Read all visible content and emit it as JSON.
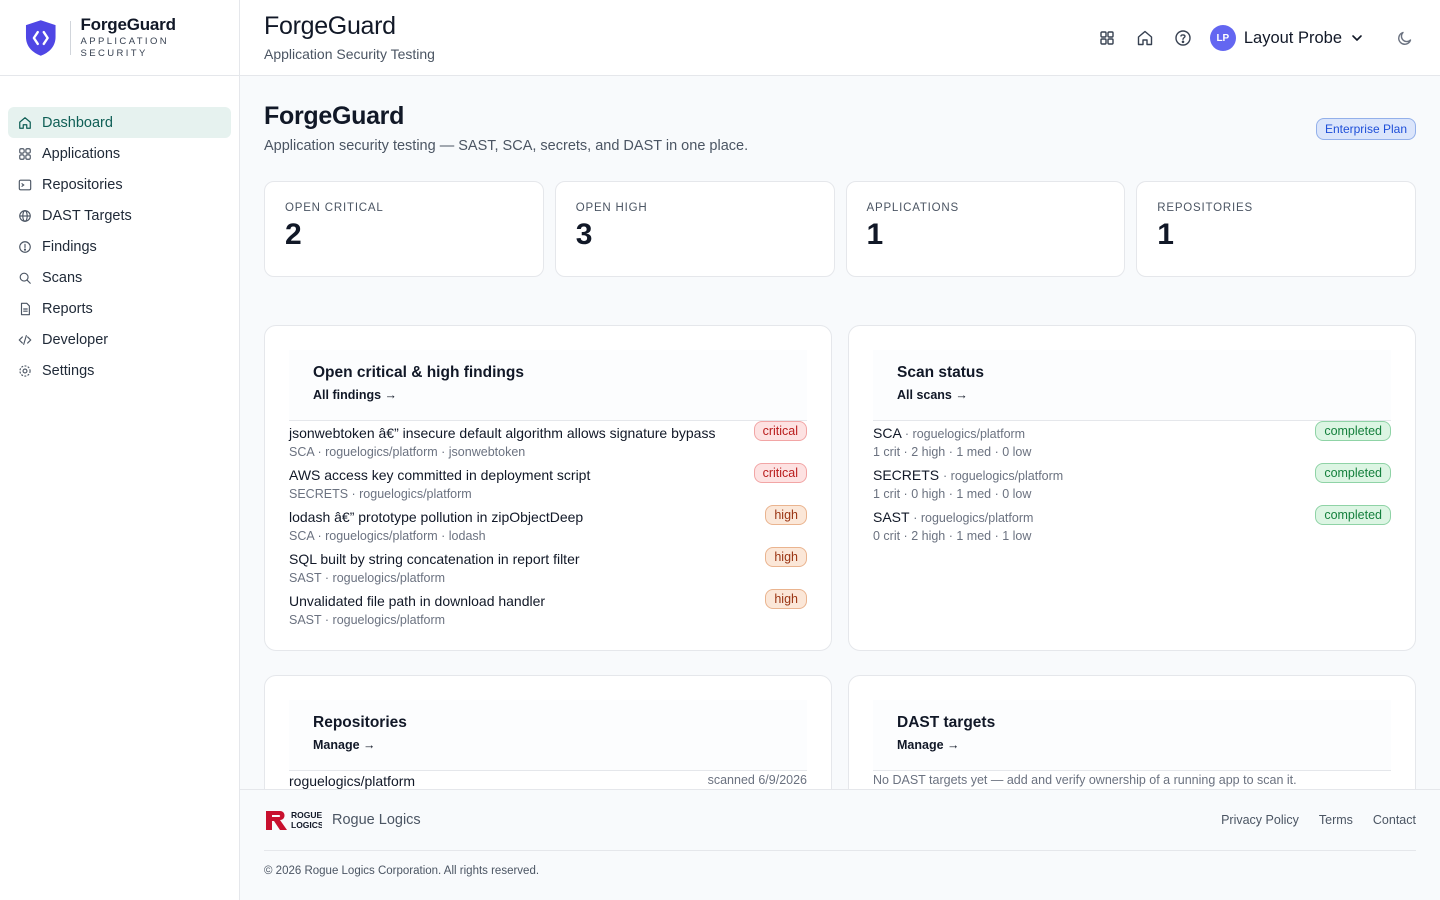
{
  "brand": {
    "name": "ForgeGuard",
    "subtitle": "APPLICATION SECURITY"
  },
  "sidebar": {
    "items": [
      {
        "label": "Dashboard",
        "icon": "home-icon",
        "active": true
      },
      {
        "label": "Applications",
        "icon": "grid-icon"
      },
      {
        "label": "Repositories",
        "icon": "terminal-window-icon"
      },
      {
        "label": "DAST Targets",
        "icon": "globe-icon"
      },
      {
        "label": "Findings",
        "icon": "alert-circle-icon"
      },
      {
        "label": "Scans",
        "icon": "search-icon"
      },
      {
        "label": "Reports",
        "icon": "document-icon"
      },
      {
        "label": "Developer",
        "icon": "code-icon"
      },
      {
        "label": "Settings",
        "icon": "gear-icon"
      }
    ]
  },
  "header": {
    "title": "ForgeGuard",
    "subtitle": "Application Security Testing",
    "user": {
      "initials": "LP",
      "name": "Layout Probe"
    }
  },
  "page": {
    "title": "ForgeGuard",
    "description": "Application security testing — SAST, SCA, secrets, and DAST in one place.",
    "plan": "Enterprise Plan"
  },
  "stats": [
    {
      "label": "OPEN CRITICAL",
      "value": "2"
    },
    {
      "label": "OPEN HIGH",
      "value": "3"
    },
    {
      "label": "APPLICATIONS",
      "value": "1"
    },
    {
      "label": "REPOSITORIES",
      "value": "1"
    }
  ],
  "findings_card": {
    "title": "Open critical & high findings",
    "link": "All findings →",
    "rows": [
      {
        "title": "jsonwebtoken â€” insecure default algorithm allows signature bypass",
        "meta": "SCA · roguelogics/platform · jsonwebtoken",
        "severity": "critical"
      },
      {
        "title": "AWS access key committed in deployment script",
        "meta": "SECRETS · roguelogics/platform",
        "severity": "critical"
      },
      {
        "title": "lodash â€” prototype pollution in zipObjectDeep",
        "meta": "SCA · roguelogics/platform · lodash",
        "severity": "high"
      },
      {
        "title": "SQL built by string concatenation in report filter",
        "meta": "SAST · roguelogics/platform",
        "severity": "high"
      },
      {
        "title": "Unvalidated file path in download handler",
        "meta": "SAST · roguelogics/platform",
        "severity": "high"
      }
    ]
  },
  "scans_card": {
    "title": "Scan status",
    "link": "All scans →",
    "rows": [
      {
        "type": "SCA",
        "repo": "· roguelogics/platform",
        "counts": "1 crit · 2 high · 1 med · 0 low",
        "status": "completed"
      },
      {
        "type": "SECRETS",
        "repo": "· roguelogics/platform",
        "counts": "1 crit · 0 high · 1 med · 0 low",
        "status": "completed"
      },
      {
        "type": "SAST",
        "repo": "· roguelogics/platform",
        "counts": "0 crit · 2 high · 1 med · 1 low",
        "status": "completed"
      }
    ]
  },
  "repos_card": {
    "title": "Repositories",
    "link": "Manage →",
    "rows": [
      {
        "name": "roguelogics/platform",
        "scanned": "scanned 6/9/2026"
      }
    ]
  },
  "dast_card": {
    "title": "DAST targets",
    "link": "Manage →",
    "empty": "No DAST targets yet — add and verify ownership of a running app to scan it."
  },
  "footer": {
    "logo_text": "ROGUE LOGICS",
    "company": "Rogue Logics",
    "links": [
      "Privacy Policy",
      "Terms",
      "Contact"
    ],
    "copyright": "© 2026 Rogue Logics Corporation. All rights reserved."
  },
  "colors": {
    "accent": "#0f5f56",
    "active_bg": "#e6f2ef",
    "brand_shield": "#4f46e5",
    "avatar": "#6366f1",
    "critical": "#b91c1c",
    "high": "#9a3412",
    "completed": "#15803d",
    "rogue_red": "#c8102e"
  }
}
